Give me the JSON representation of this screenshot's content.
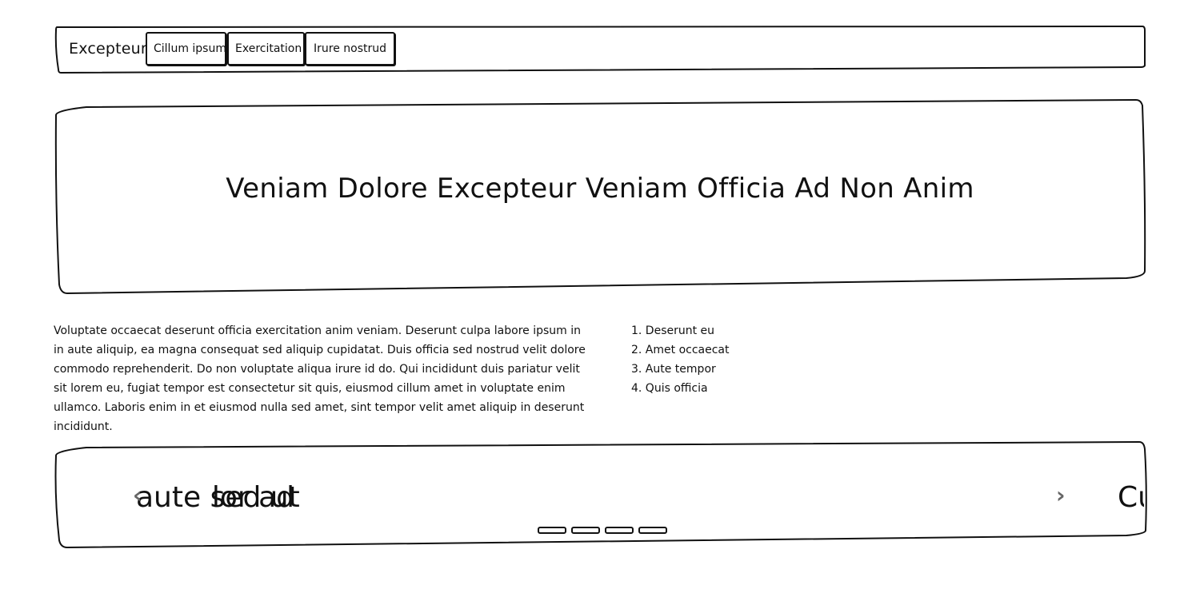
{
  "nav": {
    "brand": "Excepteur",
    "links": [
      "Cillum ipsum",
      "Exercitation",
      "Irure nostrud"
    ]
  },
  "hero": {
    "title": "Veniam Dolore Excepteur Veniam Officia Ad Non Anim"
  },
  "content": {
    "paragraph": "Voluptate occaecat deserunt officia exercitation anim veniam. Deserunt culpa labore ipsum in in aute aliquip, ea magna consequat sed aliquip cupidatat. Duis officia sed nostrud velit dolore commodo reprehenderit. Do non voluptate aliqua irure id do. Qui incididunt duis pariatur velit sit lorem eu, fugiat tempor est consectetur sit quis, eiusmod cillum amet in voluptate enim ullamco. Laboris enim in et eiusmod nulla sed amet, sint tempor velit amet aliquip in deserunt incididunt.",
    "list": [
      "1. Deserunt eu",
      "2. Amet occaecat",
      "3. Aute tempor",
      "4. Quis officia"
    ]
  },
  "carousel": {
    "prev_slide_text": "lor ad",
    "current_slide_text": "aute sed ut",
    "next_slide_text": "Cu",
    "prev_icon": "chevron-left-icon",
    "next_icon": "chevron-right-icon",
    "prev_glyph": "‹",
    "next_glyph": "›",
    "indicator_count": 4
  }
}
